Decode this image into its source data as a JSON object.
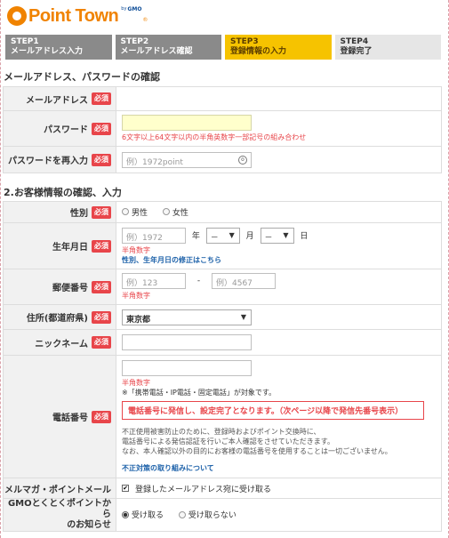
{
  "logo": {
    "text": "Point Town",
    "by": "by",
    "gmo": "GMO",
    "tm": "®"
  },
  "steps": [
    {
      "num": "STEP1",
      "label": "メールアドレス入力"
    },
    {
      "num": "STEP2",
      "label": "メールアドレス確認"
    },
    {
      "num": "STEP3",
      "label": "登録情報の入力"
    },
    {
      "num": "STEP4",
      "label": "登録完了"
    }
  ],
  "section1_title": "メールアドレス、パスワードの確認",
  "section2_title": "2.お客様情報の確認、入力",
  "required_badge": "必須",
  "fields": {
    "email": {
      "label": "メールアドレス"
    },
    "password": {
      "label": "パスワード",
      "hint": "6文字以上64文字以内の半角英数字一部記号の組み合わせ"
    },
    "password_confirm": {
      "label": "パスワードを再入力",
      "placeholder": "例）1972point"
    },
    "gender": {
      "label": "性別",
      "options": [
        "男性",
        "女性"
      ]
    },
    "birthday": {
      "label": "生年月日",
      "year_placeholder": "例）1972",
      "year_unit": "年",
      "month_value": "－",
      "month_unit": "月",
      "day_value": "－",
      "day_unit": "日",
      "note": "半角数字",
      "link": "性別、生年月日の修正はこちら"
    },
    "postal": {
      "label": "郵便番号",
      "first_placeholder": "例）123",
      "dash": "-",
      "second_placeholder": "例）4567",
      "note": "半角数字"
    },
    "address": {
      "label": "住所(都道府県)",
      "value": "東京都"
    },
    "nickname": {
      "label": "ニックネーム"
    },
    "phone": {
      "label": "電話番号",
      "note": "半角数字",
      "types_line": "※「携帯電話・IP電話・固定電話」が対象です。",
      "alert": "電話番号に発信し、設定完了となります。（次ページ以降で発信先番号表示）",
      "desc1": "不正使用被害防止のために、登録時およびポイント交換時に、",
      "desc2": "電話番号による発信認証を行いご本人確認をさせていただきます。",
      "desc3": "なお、本人確認以外の目的にお客様の電話番号を使用することは一切ございません。",
      "link": "不正対策の取り組みについて"
    },
    "mailmag": {
      "label": "メルマガ・ポイントメール",
      "check_label": "登録したメールアドレス宛に受け取る"
    },
    "gmo_notice": {
      "label_line1": "GMOとくとくポイントから",
      "label_line2": "のお知らせ",
      "options": [
        "受け取る",
        "受け取らない"
      ]
    }
  },
  "icons": {
    "eye": "eye-icon",
    "arrow": "▼",
    "check": "✔"
  }
}
